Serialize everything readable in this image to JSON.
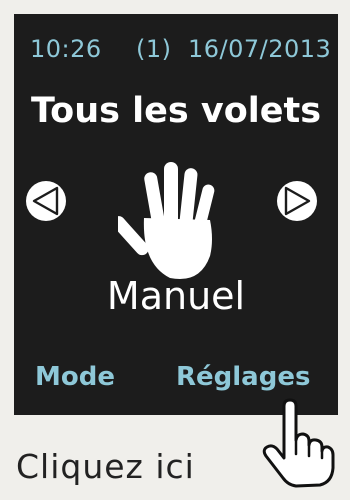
{
  "status_bar": {
    "time": "10:26",
    "count": "(1)",
    "date": "16/07/2013"
  },
  "zone_title": "Tous les volets",
  "mode": {
    "icon": "hand-icon",
    "label": "Manuel"
  },
  "navigation": {
    "previous_icon": "triangle-left-icon",
    "next_icon": "triangle-right-icon"
  },
  "soft_keys": {
    "left_label": "Mode",
    "right_label": "Réglages"
  },
  "hint": {
    "icon": "pointing-hand-icon",
    "caption": "Cliquez ici"
  },
  "colors": {
    "screen_background": "#1c1c1c",
    "accent_text": "#8ec8d8",
    "primary_text": "#ffffff",
    "page_background": "#f0efeb"
  }
}
